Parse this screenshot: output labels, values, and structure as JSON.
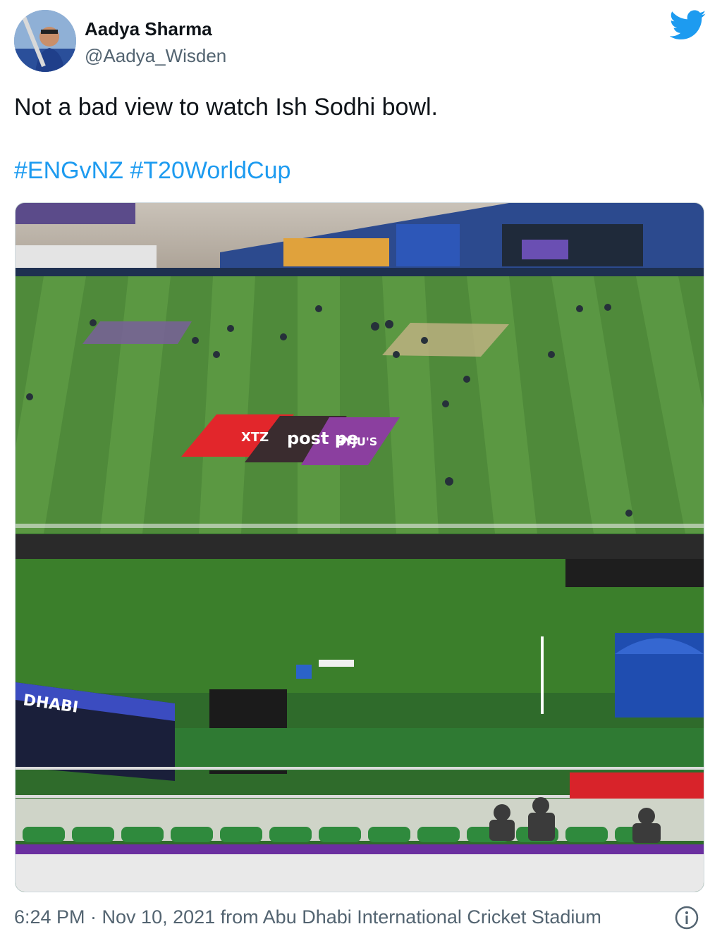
{
  "author": {
    "name": "Aadya Sharma",
    "handle": "@Aadya_Wisden"
  },
  "icons": {
    "platform": "twitter-bird-icon",
    "info": "info-icon"
  },
  "tweet": {
    "text": "Not a bad view to watch Ish Sodhi bowl.",
    "hashtags": [
      "#ENGvNZ",
      "#T20WorldCup"
    ]
  },
  "photo": {
    "signage": {
      "ground_logo_1": "XTZ",
      "ground_logo_2": "post pe",
      "ground_logo_3": "BYJU'S",
      "scoreboard_label": "DHABI"
    }
  },
  "meta": {
    "timestamp": "6:24 PM · Nov 10, 2021 from Abu Dhabi International Cricket Stadium"
  },
  "colors": {
    "brand_blue": "#1d9bf0",
    "text_primary": "#0f1419",
    "text_secondary": "#536471"
  }
}
